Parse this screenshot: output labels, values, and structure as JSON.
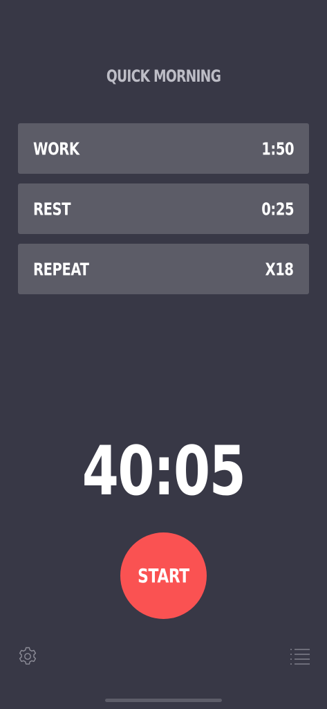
{
  "workout": {
    "title": "QUICK MORNING"
  },
  "settings_rows": [
    {
      "label": "WORK",
      "value": "1:50"
    },
    {
      "label": "REST",
      "value": "0:25"
    },
    {
      "label": "REPEAT",
      "value": "X18"
    }
  ],
  "timer": {
    "total": "40:05"
  },
  "controls": {
    "start_label": "START",
    "settings_icon": "gear-icon",
    "list_icon": "list-icon"
  },
  "colors": {
    "background": "#383846",
    "row_background": "#5c5c67",
    "title": "#bdbdc6",
    "accent": "#fa5252",
    "text": "#ffffff"
  }
}
